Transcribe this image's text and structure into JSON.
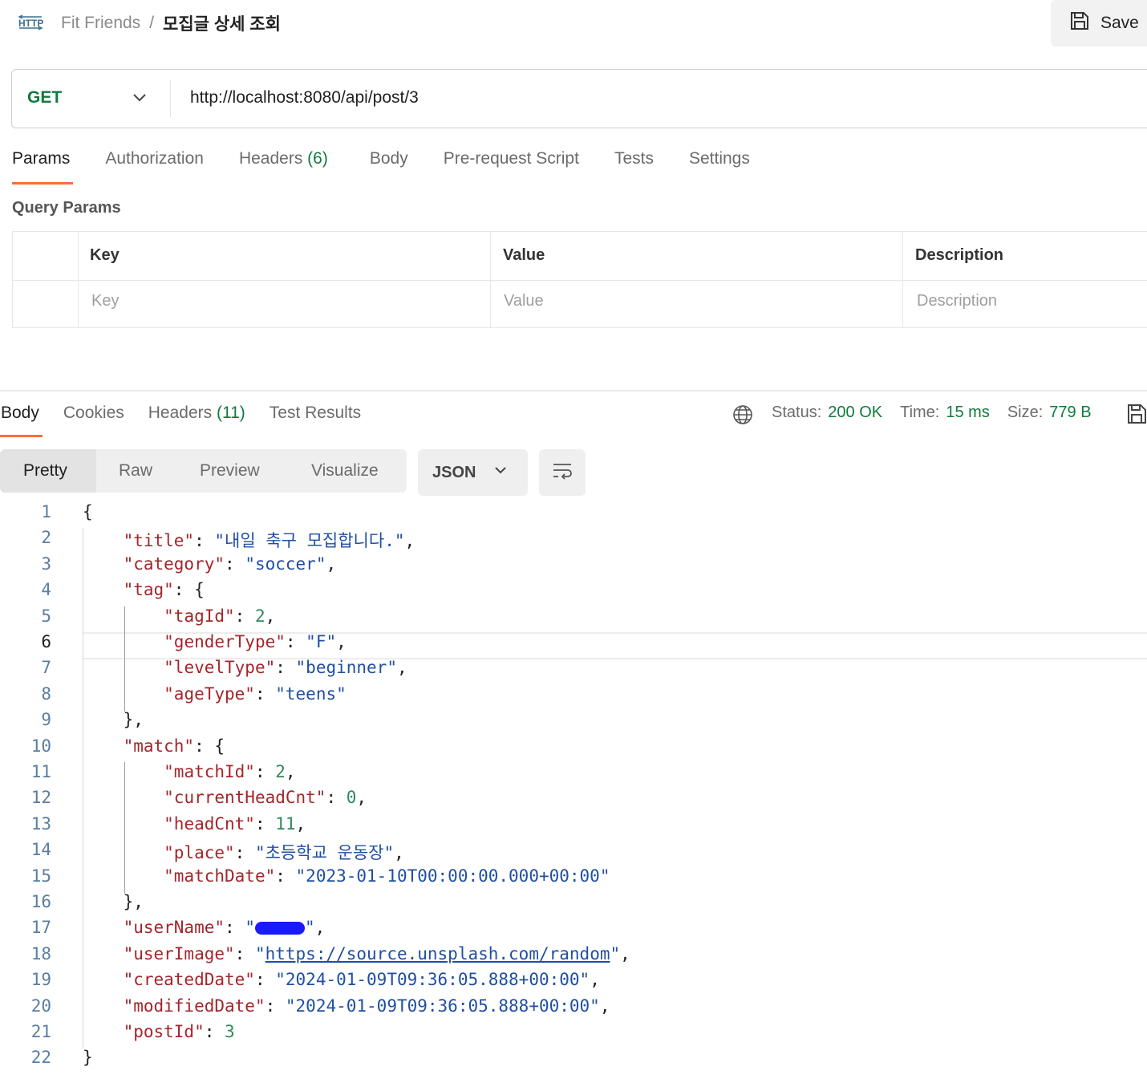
{
  "header": {
    "breadcrumb_parent": "Fit Friends",
    "breadcrumb_separator": "/",
    "breadcrumb_current": "모집글 상세 조회",
    "save_label": "Save"
  },
  "request": {
    "method": "GET",
    "url": "http://localhost:8080/api/post/3",
    "tabs": {
      "params": "Params",
      "authorization": "Authorization",
      "headers": "Headers",
      "headers_count": "(6)",
      "body": "Body",
      "prerequest": "Pre-request Script",
      "tests": "Tests",
      "settings": "Settings"
    },
    "query_params_title": "Query Params",
    "table": {
      "headers": [
        "Key",
        "Value",
        "Description"
      ],
      "placeholders": [
        "Key",
        "Value",
        "Description"
      ]
    }
  },
  "response": {
    "tabs": {
      "body": "Body",
      "cookies": "Cookies",
      "headers": "Headers",
      "headers_count": "(11)",
      "test_results": "Test Results"
    },
    "status_label": "Status:",
    "status_value": "200 OK",
    "time_label": "Time:",
    "time_value": "15 ms",
    "size_label": "Size:",
    "size_value": "779 B",
    "view_modes": [
      "Pretty",
      "Raw",
      "Preview",
      "Visualize"
    ],
    "format": "JSON",
    "current_line": 6,
    "code_lines": [
      "{",
      "    \"title\": \"내일 축구 모집합니다.\",",
      "    \"category\": \"soccer\",",
      "    \"tag\": {",
      "        \"tagId\": 2,",
      "        \"genderType\": \"F\",",
      "        \"levelType\": \"beginner\",",
      "        \"ageType\": \"teens\"",
      "    },",
      "    \"match\": {",
      "        \"matchId\": 2,",
      "        \"currentHeadCnt\": 0,",
      "        \"headCnt\": 11,",
      "        \"place\": \"초등학교 운동장\",",
      "        \"matchDate\": \"2023-01-10T00:00:00.000+00:00\"",
      "    },",
      "    \"userName\": \"\",",
      "    \"userImage\": \"https://source.unsplash.com/random\",",
      "    \"createdDate\": \"2024-01-09T09:36:05.888+00:00\",",
      "    \"modifiedDate\": \"2024-01-09T09:36:05.888+00:00\",",
      "    \"postId\": 3",
      "}"
    ]
  },
  "colors": {
    "accent": "#ff6c37",
    "method_get": "#0f7b3c",
    "status_ok": "#0f7b3c",
    "json_key": "#a3262b",
    "json_string": "#1f4fa3",
    "json_number": "#2f8a5a",
    "redaction": "#1a1aff"
  },
  "icons": {
    "http": "http-icon",
    "save": "floppy-disk-icon",
    "method_dropdown": "chevron-down-icon",
    "globe": "globe-icon",
    "save_response": "floppy-disk-icon",
    "format_dropdown": "chevron-down-icon",
    "wrap": "text-wrap-icon"
  }
}
